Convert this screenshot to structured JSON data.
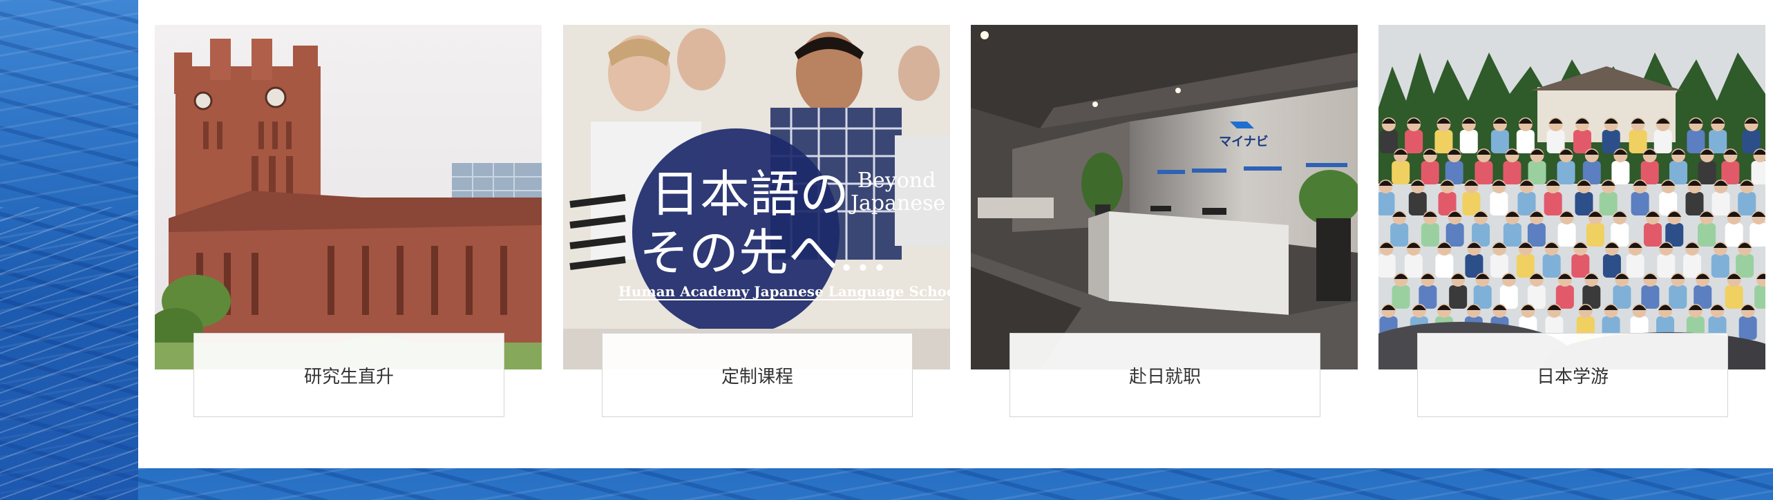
{
  "cards": [
    {
      "label": "研究生直升",
      "image": "university-clock-tower-photo"
    },
    {
      "label": "定制课程",
      "image": "students-classroom-photo",
      "overlay": {
        "line1": "日本語の",
        "line2": "その先へ…",
        "side1": "Beyond",
        "side2": "Japanese",
        "caption": "Human Academy Japanese Language School"
      }
    },
    {
      "label": "赴日就职",
      "image": "mynavi-office-reception-photo",
      "logo_text": "マイナビ"
    },
    {
      "label": "日本学游",
      "image": "student-group-mountain-photo"
    }
  ]
}
